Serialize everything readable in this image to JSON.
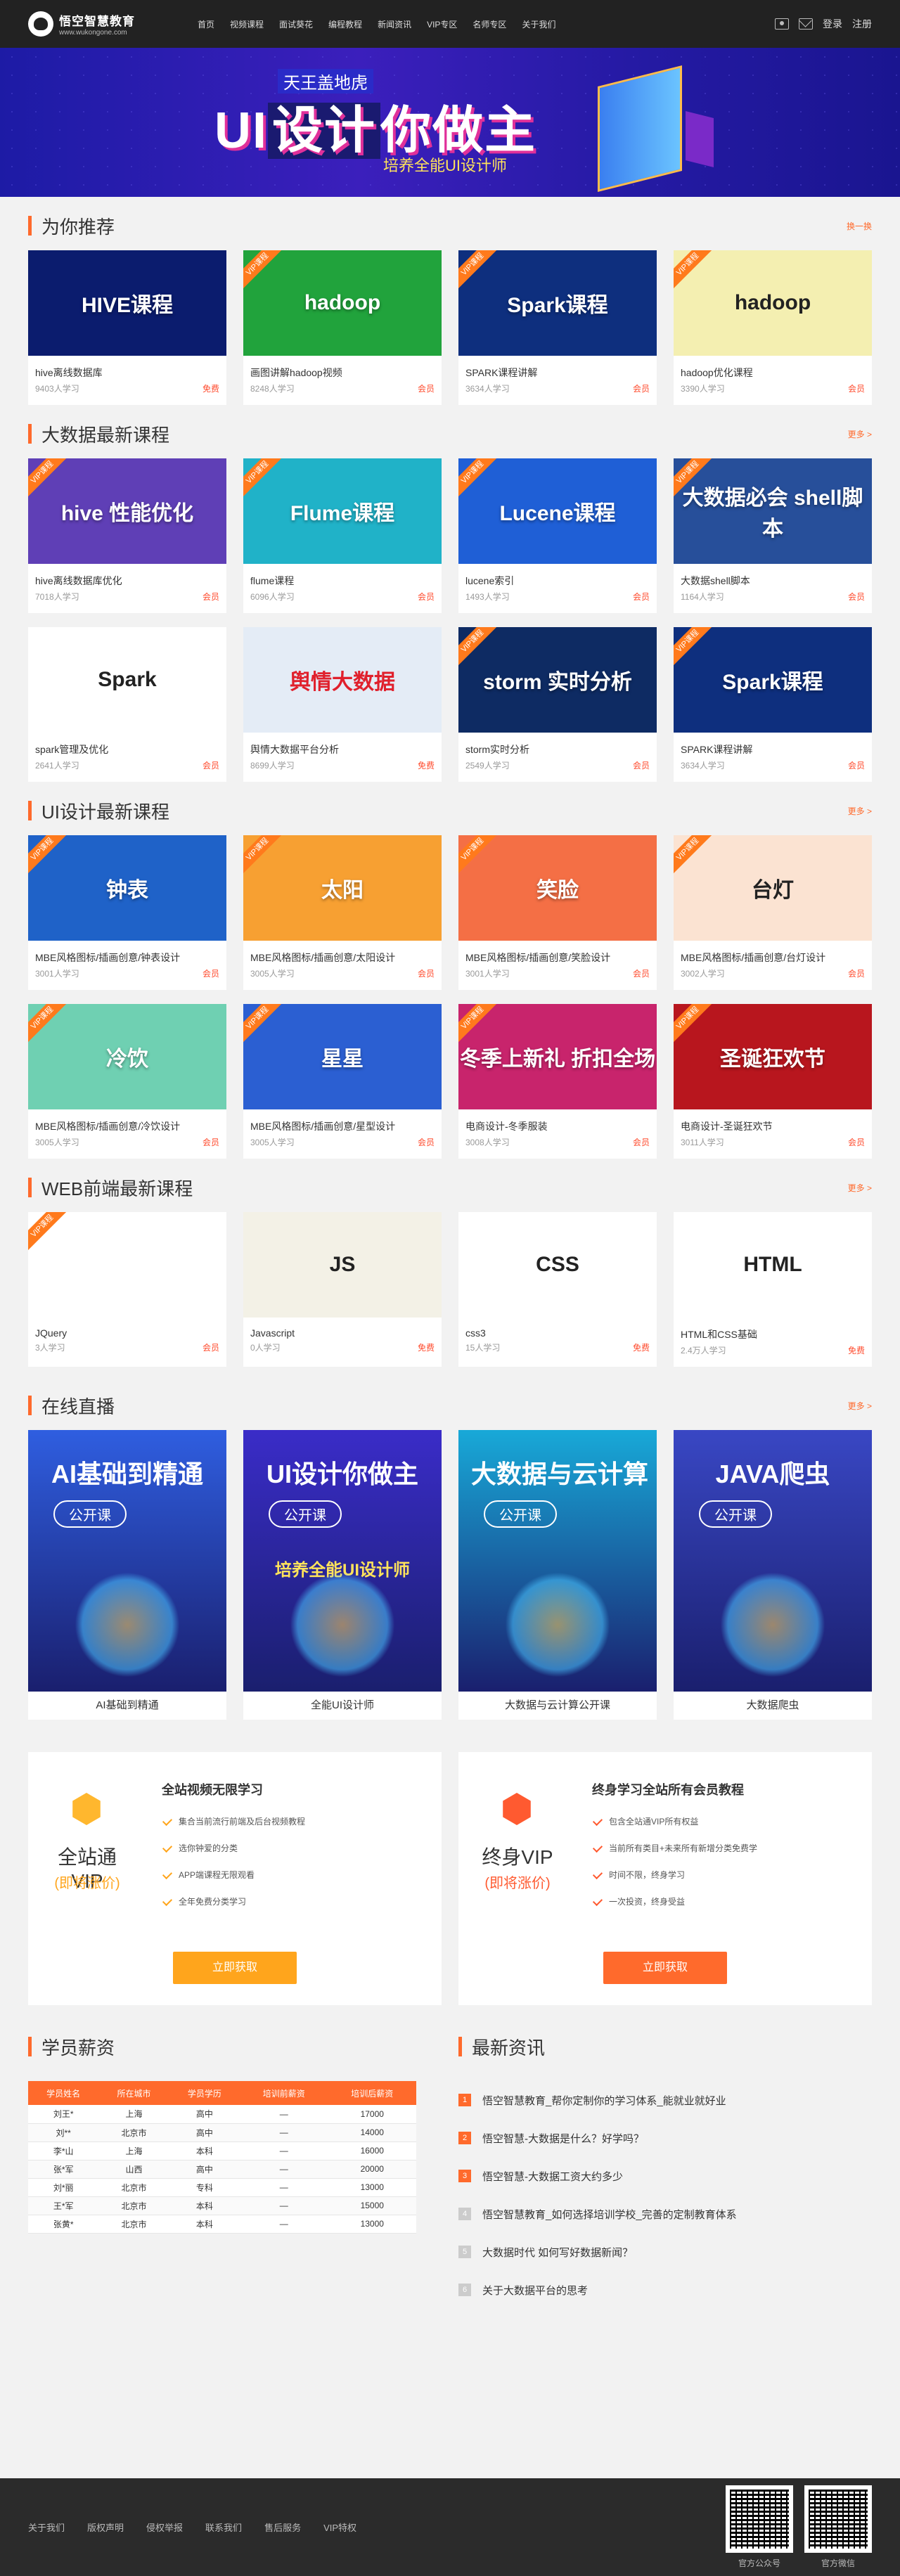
{
  "header": {
    "logo_title": "悟空智慧教育",
    "logo_url": "www.wukongone.com",
    "nav": [
      "首页",
      "视频课程",
      "面试葵花",
      "编程教程",
      "新闻资讯",
      "VIP专区",
      "名师专区",
      "关于我们"
    ],
    "login": "登录",
    "register": "注册"
  },
  "banner": {
    "top": "天王盖地虎",
    "main_a": "UI",
    "main_b": "设计",
    "main_c": "你做主",
    "sub": "培养全能UI设计师"
  },
  "recommend": {
    "title": "为你推荐",
    "more": "换一换",
    "items": [
      {
        "thumb": "HIVE课程",
        "name": "hive离线数据库",
        "learners": "9403人学习",
        "tag": "免费",
        "vip": false,
        "bg": "#0b1c6e"
      },
      {
        "thumb": "hadoop",
        "name": "画图讲解hadoop视频",
        "learners": "8248人学习",
        "tag": "会员",
        "vip": true,
        "bg": "#21a33c"
      },
      {
        "thumb": "Spark课程",
        "name": "SPARK课程讲解",
        "learners": "3634人学习",
        "tag": "会员",
        "vip": true,
        "bg": "#0e2f7e"
      },
      {
        "thumb": "hadoop",
        "name": "hadoop优化课程",
        "learners": "3390人学习",
        "tag": "会员",
        "vip": true,
        "bg": "#f4efb1"
      }
    ]
  },
  "bigdata": {
    "title": "大数据最新课程",
    "more": "更多 >",
    "items": [
      {
        "thumb": "hive 性能优化",
        "name": "hive离线数据库优化",
        "learners": "7018人学习",
        "tag": "会员",
        "vip": true,
        "bg": "#5f3fb6"
      },
      {
        "thumb": "Flume课程",
        "name": "flume课程",
        "learners": "6096人学习",
        "tag": "会员",
        "vip": true,
        "bg": "#20b2c8"
      },
      {
        "thumb": "Lucene课程",
        "name": "lucene索引",
        "learners": "1493人学习",
        "tag": "会员",
        "vip": true,
        "bg": "#1f5fd6"
      },
      {
        "thumb": "大数据必会 shell脚本",
        "name": "大数据shell脚本",
        "learners": "1164人学习",
        "tag": "会员",
        "vip": true,
        "bg": "#274f9a"
      },
      {
        "thumb": "Spark",
        "name": "spark管理及优化",
        "learners": "2641人学习",
        "tag": "会员",
        "vip": false,
        "bg": "#ffffff"
      },
      {
        "thumb": "舆情大数据",
        "name": "舆情大数据平台分析",
        "learners": "8699人学习",
        "tag": "免费",
        "vip": false,
        "bg": "#e4ecf6"
      },
      {
        "thumb": "storm 实时分析",
        "name": "storm实时分析",
        "learners": "2549人学习",
        "tag": "会员",
        "vip": true,
        "bg": "#0e2b63"
      },
      {
        "thumb": "Spark课程",
        "name": "SPARK课程讲解",
        "learners": "3634人学习",
        "tag": "会员",
        "vip": true,
        "bg": "#0e2f7e"
      }
    ]
  },
  "ui": {
    "title": "UI设计最新课程",
    "more": "更多 >",
    "items": [
      {
        "thumb": "钟表",
        "name": "MBE风格图标/插画创意/钟表设计",
        "learners": "3001人学习",
        "tag": "会员",
        "vip": true,
        "bg": "#1f62c8"
      },
      {
        "thumb": "太阳",
        "name": "MBE风格图标/插画创意/太阳设计",
        "learners": "3005人学习",
        "tag": "会员",
        "vip": true,
        "bg": "#f7a032"
      },
      {
        "thumb": "笑脸",
        "name": "MBE风格图标/插画创意/笑脸设计",
        "learners": "3001人学习",
        "tag": "会员",
        "vip": true,
        "bg": "#f46f45"
      },
      {
        "thumb": "台灯",
        "name": "MBE风格图标/插画创意/台灯设计",
        "learners": "3002人学习",
        "tag": "会员",
        "vip": true,
        "bg": "#fbe3d2"
      },
      {
        "thumb": "冷饮",
        "name": "MBE风格图标/插画创意/冷饮设计",
        "learners": "3005人学习",
        "tag": "会员",
        "vip": true,
        "bg": "#6fd0b2"
      },
      {
        "thumb": "星星",
        "name": "MBE风格图标/插画创意/星型设计",
        "learners": "3005人学习",
        "tag": "会员",
        "vip": true,
        "bg": "#2b5fd2"
      },
      {
        "thumb": "冬季上新礼 折扣全场",
        "name": "电商设计-冬季服装",
        "learners": "3008人学习",
        "tag": "会员",
        "vip": true,
        "bg": "#c8246c"
      },
      {
        "thumb": "圣诞狂欢节",
        "name": "电商设计-圣诞狂欢节",
        "learners": "3011人学习",
        "tag": "会员",
        "vip": true,
        "bg": "#b8161e"
      }
    ]
  },
  "web": {
    "title": "WEB前端最新课程",
    "more": "更多 >",
    "items": [
      {
        "thumb": "",
        "name": "JQuery",
        "learners": "3人学习",
        "tag": "会员",
        "vip": true,
        "bg": "#ffffff"
      },
      {
        "thumb": "JS",
        "name": "Javascript",
        "learners": "0人学习",
        "tag": "免费",
        "vip": false,
        "bg": "#f3f1e6"
      },
      {
        "thumb": "CSS",
        "name": "css3",
        "learners": "15人学习",
        "tag": "免费",
        "vip": false,
        "bg": "#ffffff"
      },
      {
        "thumb": "HTML",
        "name": "HTML和CSS基础",
        "learners": "2.4万人学习",
        "tag": "免费",
        "vip": false,
        "bg": "#ffffff"
      }
    ]
  },
  "live": {
    "title": "在线直播",
    "more": "更多 >",
    "pill": "公开课",
    "items": [
      {
        "thumb": "AI基础到精通",
        "caption": "AI基础到精通",
        "extra": "",
        "bg": "#2f5ee0"
      },
      {
        "thumb": "UI设计你做主",
        "caption": "全能UI设计师",
        "extra": "培养全能UI设计师",
        "bg": "#3a2cc8"
      },
      {
        "thumb": "大数据与云计算",
        "caption": "大数据与云计算公开课",
        "extra": "",
        "bg": "#18a9d8"
      },
      {
        "thumb": "JAVA爬虫",
        "caption": "大数据爬虫",
        "extra": "",
        "bg": "#3947c4"
      }
    ]
  },
  "vip": [
    {
      "name": "全站通VIP",
      "price": "(即将涨价)",
      "heading": "全站视频无限学习",
      "points": [
        "集合当前流行前端及后台视频教程",
        "选你钟爱的分类",
        "APP端课程无限观看",
        "全年免费分类学习"
      ],
      "button": "立即获取",
      "accent": "#ffa51c"
    },
    {
      "name": "终身VIP",
      "price": "(即将涨价)",
      "heading": "终身学习全站所有会员教程",
      "points": [
        "包含全站通VIP所有权益",
        "当前所有类目+未来所有新增分类免费学",
        "时间不限，终身学习",
        "一次投资，终身受益"
      ],
      "button": "立即获取",
      "accent": "#ff5a30"
    }
  ],
  "salary": {
    "title": "学员薪资",
    "headers": [
      "学员姓名",
      "所在城市",
      "学员学历",
      "培训前薪资",
      "培训后薪资"
    ],
    "rows": [
      [
        "刘王*",
        "上海",
        "高中",
        "—",
        "17000"
      ],
      [
        "刘**",
        "北京市",
        "高中",
        "—",
        "14000"
      ],
      [
        "李*山",
        "上海",
        "本科",
        "—",
        "16000"
      ],
      [
        "张*军",
        "山西",
        "高中",
        "—",
        "20000"
      ],
      [
        "刘*丽",
        "北京市",
        "专科",
        "—",
        "13000"
      ],
      [
        "王*军",
        "北京市",
        "本科",
        "—",
        "15000"
      ],
      [
        "张黄*",
        "北京市",
        "本科",
        "—",
        "13000"
      ]
    ]
  },
  "news": {
    "title": "最新资讯",
    "items": [
      "悟空智慧教育_帮你定制你的学习体系_能就业就好业",
      "悟空智慧-大数据是什么？好学吗？",
      "悟空智慧-大数据工资大约多少",
      "悟空智慧教育_如何选择培训学校_完善的定制教育体系",
      "大数据时代 如何写好数据新闻？",
      "关于大数据平台的思考"
    ]
  },
  "footer": {
    "links": [
      "关于我们",
      "版权声明",
      "侵权举报",
      "联系我们",
      "售后服务",
      "VIP特权"
    ],
    "qr": [
      "官方公众号",
      "官方微信"
    ]
  }
}
